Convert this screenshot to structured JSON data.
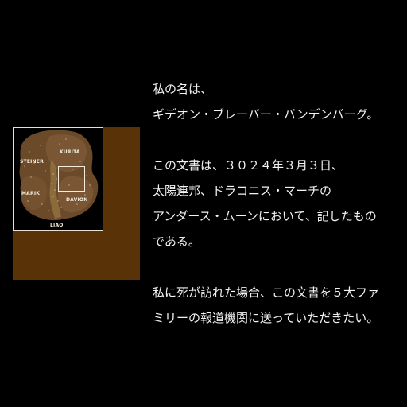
{
  "colors": {
    "background": "#000000",
    "panel": "#5a3208",
    "map_frame": "#e8e0d0",
    "text": "#f2f2f2",
    "galaxy_dark": "#6b4a2a",
    "galaxy_light": "#8a6640"
  },
  "map": {
    "labels": {
      "steiner": "STEINER",
      "kurita": "KURITA",
      "marik": "MARIK",
      "davion": "DAVION",
      "liao": "LIAO"
    }
  },
  "story": {
    "paragraph1": [
      "私の名は、",
      "ギデオン・ブレーバー・バンデンバーグ。"
    ],
    "paragraph2": [
      "この文書は、３０２４年３月３日、",
      "太陽連邦、ドラコニス・マーチの",
      "アンダース・ムーンにおいて、記したもの",
      "である。"
    ],
    "paragraph3": [
      "私に死が訪れた場合、この文書を５大ファ",
      "ミリーの報道機関に送っていただきたい。"
    ]
  }
}
